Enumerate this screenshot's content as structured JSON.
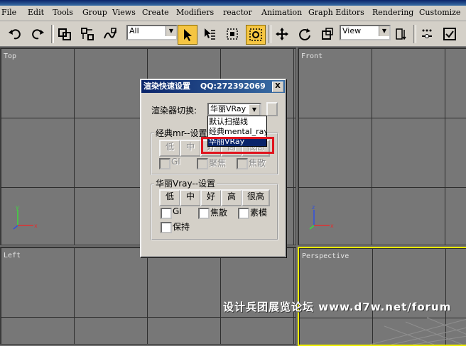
{
  "menu": {
    "items": [
      "File",
      "Edit",
      "Tools",
      "Group",
      "Views",
      "Create",
      "Modifiers",
      "reactor",
      "Animation",
      "Graph Editors",
      "Rendering",
      "Customize"
    ]
  },
  "toolbar": {
    "selection_filter": "All",
    "ref_coord": "View"
  },
  "viewports": {
    "top": "Top",
    "front": "Front",
    "left": "Left",
    "perspective": "Perspective"
  },
  "dialog": {
    "title": "渲染快速设置",
    "qq": "QQ:272392069",
    "close_label": "X",
    "renderer_label": "渲染器切换:",
    "renderer_value": "华丽VRay",
    "dropdown_options": [
      "默认扫描线",
      "经典mental_ray",
      "华丽VRay"
    ],
    "classic_group_title": "经典mr--设置",
    "classic_quality": [
      "低",
      "中",
      "好",
      "高",
      "很高"
    ],
    "classic_checks": [
      "GI",
      "聚焦",
      "焦散"
    ],
    "vray_group_title": "华丽Vray--设置",
    "vray_quality": [
      "低",
      "中",
      "好",
      "高",
      "很高"
    ],
    "vray_checks_row1": [
      "GI",
      "焦散",
      "素模"
    ],
    "vray_checks_row2": [
      "保持"
    ]
  },
  "watermark": "设计兵团展览论坛 www.d7w.net/forum",
  "colors": {
    "viewport_bg": "#777777",
    "active_viewport_border": "#f0f000",
    "highlight_box": "#e0141e",
    "title_bar": "#0a246a"
  }
}
